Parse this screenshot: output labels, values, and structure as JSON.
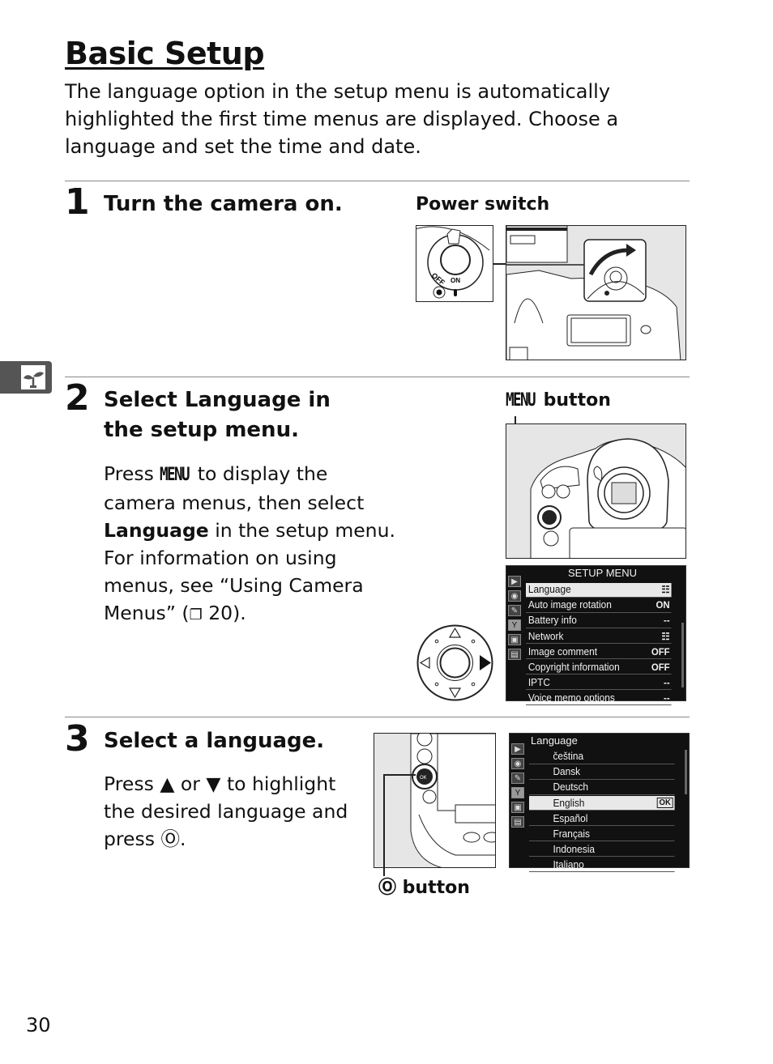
{
  "page": {
    "title": "Basic Setup",
    "intro": "The language option in the setup menu is automatically highlighted the first time menus are displayed. Choose a language and set the time and date.",
    "page_number": "30",
    "side_tab_icon": "sprout-icon"
  },
  "steps": [
    {
      "number": "1",
      "heading": "Turn the camera on.",
      "figure_label": "Power switch",
      "switch_labels": {
        "off": "OFF",
        "on": "ON"
      }
    },
    {
      "number": "2",
      "heading_pre": "Select ",
      "heading_bold": "Language",
      "heading_post": " in the setup menu.",
      "figure_label_glyph": "MENU",
      "figure_label_text": " button",
      "body": {
        "p1_pre": "Press ",
        "p1_glyph": "MENU",
        "p1_post": " to display the camera menus, then select ",
        "bold": "Language",
        "p2": " in the setup menu. For information on using menus, see “Using Camera Menus” (",
        "ref_icon": "❐",
        "ref_page": " 20)."
      },
      "setup_menu": {
        "title": "SETUP MENU",
        "items": [
          {
            "label": "Language",
            "value": "☷",
            "selected": true
          },
          {
            "label": "Auto image rotation",
            "value": "ON"
          },
          {
            "label": "Battery info",
            "value": "--"
          },
          {
            "label": "Network",
            "value": "☷"
          },
          {
            "label": "Image comment",
            "value": "OFF"
          },
          {
            "label": "Copyright information",
            "value": "OFF"
          },
          {
            "label": "IPTC",
            "value": "--"
          },
          {
            "label": "Voice memo options",
            "value": "--"
          }
        ]
      }
    },
    {
      "number": "3",
      "heading": "Select a language.",
      "body": {
        "pre": "Press ",
        "up": "▲",
        "mid": " or ",
        "down": "▼",
        "post": " to highlight the desired language and press ",
        "ok": "Ⓞ",
        "end": "."
      },
      "figure_label_icon": "Ⓞ",
      "figure_label_text": " button",
      "language_menu": {
        "title": "Language",
        "items": [
          {
            "label": "čeština"
          },
          {
            "label": "Dansk"
          },
          {
            "label": "Deutsch"
          },
          {
            "label": "English",
            "selected": true,
            "badge": "OK"
          },
          {
            "label": "Español"
          },
          {
            "label": "Français"
          },
          {
            "label": "Indonesia"
          },
          {
            "label": "Italiano"
          }
        ]
      }
    }
  ],
  "menu_tab_icons": [
    "playback-icon",
    "camera-icon",
    "pencil-icon",
    "wrench-icon",
    "retouch-icon",
    "my-menu-icon"
  ]
}
